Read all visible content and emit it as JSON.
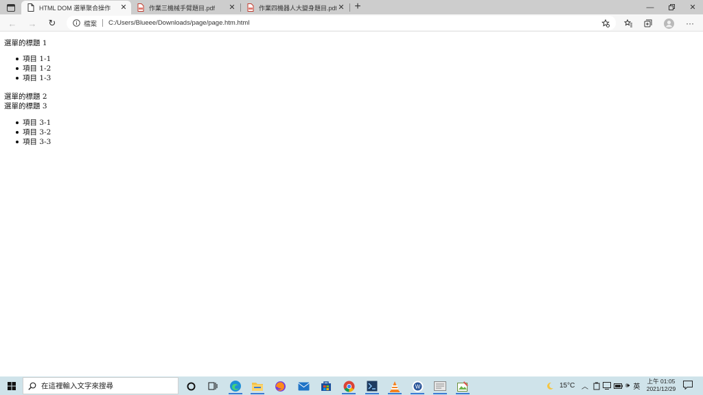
{
  "browser": {
    "tabs": [
      {
        "title": "HTML DOM 選單聚合操作",
        "active": true,
        "icon": "page-icon"
      },
      {
        "title": "作業三機械手臂題目.pdf",
        "active": false,
        "icon": "pdf-icon"
      },
      {
        "title": "作業四機器人大變身題目.pdf",
        "active": false,
        "icon": "pdf-icon"
      }
    ],
    "address": {
      "scheme_label": "檔案",
      "url": "C:/Users/Blueee/Downloads/page/page.htm.html"
    }
  },
  "page": {
    "menus": [
      {
        "title": "選單的標題 1",
        "items": [
          "項目 1-1",
          "項目 1-2",
          "項目 1-3"
        ]
      },
      {
        "title": "選單的標題 2",
        "items": []
      },
      {
        "title": "選單的標題 3",
        "items": [
          "項目 3-1",
          "項目 3-2",
          "項目 3-3"
        ]
      }
    ]
  },
  "taskbar": {
    "search_placeholder": "在這裡輸入文字來搜尋",
    "weather": "15°C",
    "ime": "英",
    "time": "上午 01:05",
    "date": "2021/12/29"
  },
  "colors": {
    "tabstrip": "#cdcdcd",
    "toolbar": "#f7f7f7",
    "taskbar": "#cfe3ea",
    "accent": "#3a7bd5"
  }
}
